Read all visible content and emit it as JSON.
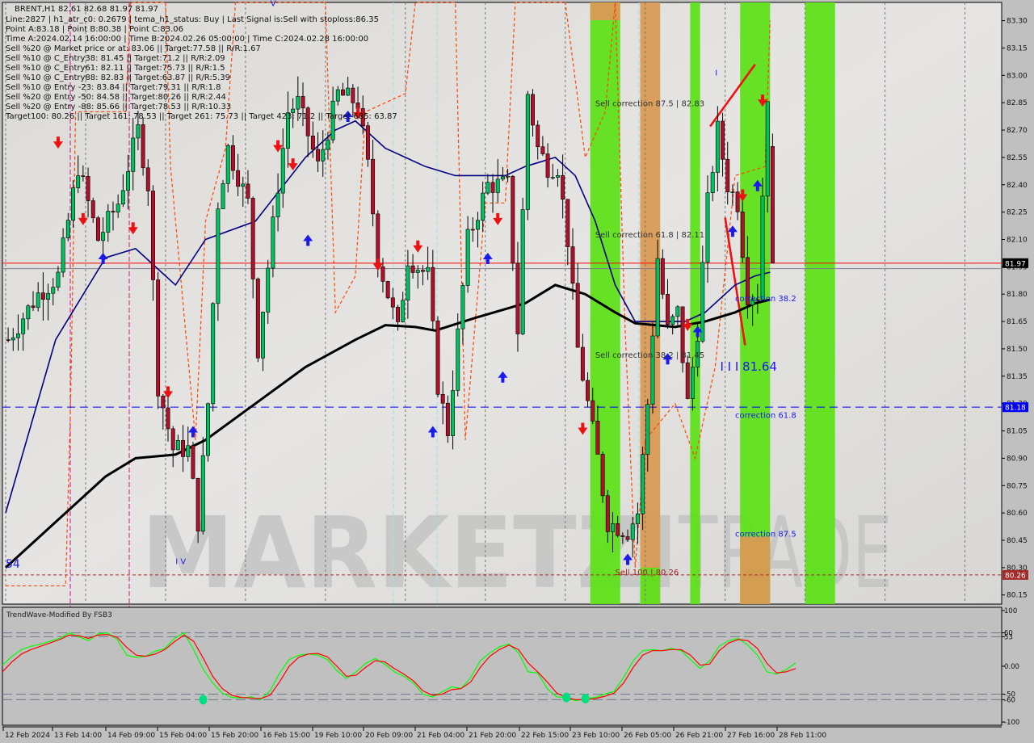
{
  "header": {
    "symbol_line": "BRENT,H1  82.61 82.68 81.97 81.97",
    "info_lines": [
      "Line:2827 | h1_atr_c0: 0.2679 | tema_h1_status: Buy | Last Signal is:Sell with stoploss:86.35",
      "Point A:83.18 | Point B:80.38 | Point C:83.06",
      "Time A:2024.02.14 16:00:00 | Time B:2024.02.26 05:00:00 | Time C:2024.02.28 16:00:00",
      "Sell %20 @ Market price or at: 83.06 || Target:77.58 || R/R:1.67",
      "Sell %10 @ C_Entry38: 81.45 || Target:71.2 || R/R:2.09",
      "Sell %10 @ C_Entry61: 82.11 || Target:75.73 || R/R:1.5",
      "Sell %10 @ C_Entry88: 82.83 || Target:63.87 || R/R:5.39",
      "Sell %10 @ Entry -23: 83.84 || Target:79.31 || R/R:1.8",
      "Sell %20 @ Entry -50: 84.58 || Target:80.26 || R/R:2.44",
      "Sell %20 @ Entry -88: 85.66 || Target:78.53 || R/R:10.33",
      "Target100: 80.26 || Target 161: 78.53 || Target 261: 75.73 || Target 423: 71.2 || Target 685: 63.87"
    ]
  },
  "watermark": {
    "left": "MARKETZI",
    "right": "TRADE"
  },
  "colors": {
    "bull": "#00c060",
    "bear": "#b0102a",
    "tema_fast": "#000080",
    "tema_slow": "#000000",
    "green_zone": "#5fe01a",
    "orange_zone": "#d99a55",
    "stop_line": "#ff4500",
    "current_price": "#ff0000",
    "blue_level": "#0000ff",
    "target_level": "#a52a2a",
    "osc_green": "#00ff00",
    "osc_red": "#ff0000",
    "osc_dot": "#00e080"
  },
  "chart_data": [
    {
      "type": "candlestick",
      "title": "BRENT,H1",
      "ylim": [
        80.1,
        83.4
      ],
      "y_ticks": [
        "83.30",
        "83.15",
        "83.00",
        "82.85",
        "82.70",
        "82.55",
        "82.40",
        "82.25",
        "82.10",
        "81.95",
        "81.80",
        "81.65",
        "81.50",
        "81.35",
        "81.20",
        "81.05",
        "80.90",
        "80.75",
        "80.60",
        "80.45",
        "80.30",
        "80.15"
      ],
      "x_ticks": [
        "12 Feb 2024",
        "13 Feb 14:00",
        "14 Feb 09:00",
        "15 Feb 04:00",
        "15 Feb 20:00",
        "16 Feb 15:00",
        "19 Feb 10:00",
        "20 Feb 09:00",
        "21 Feb 04:00",
        "21 Feb 20:00",
        "22 Feb 15:00",
        "23 Feb 10:00",
        "26 Feb 05:00",
        "26 Feb 21:00",
        "27 Feb 16:00",
        "28 Feb 11:00"
      ],
      "ohlc_last": {
        "open": 82.61,
        "high": 82.68,
        "low": 81.97,
        "close": 81.97
      },
      "price_labels": [
        {
          "value": "81.97",
          "kind": "current"
        },
        {
          "value": "81.18",
          "kind": "blue-level"
        },
        {
          "value": "80.26",
          "kind": "target"
        }
      ],
      "levels": [
        {
          "name": "current-price",
          "value": 81.97
        },
        {
          "name": "correction-level",
          "value": 81.18
        },
        {
          "name": "sell-100-target",
          "value": 80.26
        }
      ],
      "annotations": [
        {
          "text": "Sell correction 87.5 | 82.83",
          "x_index": 118,
          "y": 82.83
        },
        {
          "text": "Sell correction 61.8 | 82.11",
          "x_index": 118,
          "y": 82.11
        },
        {
          "text": "Sell correction 38.2 | 81.45",
          "x_index": 118,
          "y": 81.45
        },
        {
          "text": "Sell 100 | 80.26",
          "x_index": 122,
          "y": 80.26
        },
        {
          "text": "correction 38.2",
          "x_index": 146,
          "y": 81.76
        },
        {
          "text": "correction 61.8",
          "x_index": 146,
          "y": 81.12
        },
        {
          "text": "correction 87.5",
          "x_index": 146,
          "y": 80.47
        },
        {
          "text": "I I I 81.64",
          "x_index": 143,
          "y": 81.38
        },
        {
          "text": "54",
          "x_index": 0,
          "y": 80.3
        },
        {
          "text": "I V",
          "x_index": 34,
          "y": 80.32
        },
        {
          "text": "V",
          "x_index": 53,
          "y": 83.38
        },
        {
          "text": "I",
          "x_index": 142,
          "y": 83.0
        }
      ],
      "zones": [
        {
          "color": "green",
          "from_index": 117,
          "to_index": 122
        },
        {
          "color": "orange",
          "from_index": 117,
          "to_index": 122,
          "partial_top": true
        },
        {
          "color": "orange",
          "from_index": 127,
          "to_index": 130
        },
        {
          "color": "green",
          "from_index": 127,
          "to_index": 130,
          "partial": true
        },
        {
          "color": "green",
          "from_index": 137,
          "to_index": 138
        },
        {
          "color": "green",
          "from_index": 147,
          "to_index": 152
        },
        {
          "color": "orange",
          "from_index": 147,
          "to_index": 152,
          "partial_bottom": true
        },
        {
          "color": "green",
          "from_index": 160,
          "to_index": 165
        }
      ]
    },
    {
      "type": "line",
      "title": "TrendWave-Modified By FSB3",
      "ylim": [
        -100,
        100
      ],
      "y_ticks": [
        "100",
        "60",
        "53",
        "0.00",
        "-50",
        "-60",
        "-100"
      ],
      "levels": [
        60,
        53,
        -50,
        -60
      ],
      "series": [
        {
          "name": "wave-green",
          "values": [
            2,
            18,
            30,
            36,
            40,
            45,
            50,
            60,
            53,
            46,
            58,
            60,
            48,
            20,
            16,
            18,
            27,
            32,
            50,
            60,
            30,
            -5,
            -30,
            -48,
            -56,
            -57,
            -55,
            -60,
            -44,
            -12,
            12,
            20,
            22,
            20,
            12,
            -8,
            -22,
            -10,
            5,
            14,
            4,
            -10,
            -18,
            -30,
            -50,
            -55,
            -46,
            -37,
            -40,
            -20,
            10,
            24,
            35,
            40,
            24,
            -10,
            -12,
            -40,
            -55,
            -56,
            -62,
            -58,
            -56,
            -50,
            -45,
            -20,
            10,
            28,
            30,
            28,
            32,
            28,
            12,
            -4,
            10,
            36,
            46,
            50,
            38,
            20,
            -10,
            -14,
            -6,
            6
          ],
          "color": "#00ff00"
        },
        {
          "name": "wave-red",
          "values": [
            -10,
            8,
            22,
            30,
            36,
            42,
            48,
            56,
            55,
            50,
            56,
            57,
            52,
            34,
            20,
            18,
            22,
            30,
            44,
            56,
            45,
            15,
            -18,
            -40,
            -52,
            -56,
            -57,
            -58,
            -52,
            -28,
            0,
            16,
            22,
            23,
            17,
            0,
            -18,
            -16,
            -2,
            10,
            8,
            -4,
            -14,
            -26,
            -44,
            -52,
            -50,
            -42,
            -40,
            -28,
            -2,
            18,
            30,
            38,
            30,
            6,
            -10,
            -28,
            -48,
            -56,
            -60,
            -60,
            -58,
            -54,
            -48,
            -30,
            -2,
            20,
            28,
            28,
            30,
            30,
            20,
            2,
            4,
            28,
            42,
            48,
            46,
            32,
            5,
            -12,
            -10,
            -4
          ],
          "color": "#ff0000"
        }
      ],
      "markers": [
        {
          "index": 21,
          "value": -60,
          "kind": "buy-dot"
        },
        {
          "index": 59,
          "value": -56,
          "kind": "buy-dot"
        },
        {
          "index": 61,
          "value": -58,
          "kind": "buy-dot"
        }
      ]
    }
  ]
}
